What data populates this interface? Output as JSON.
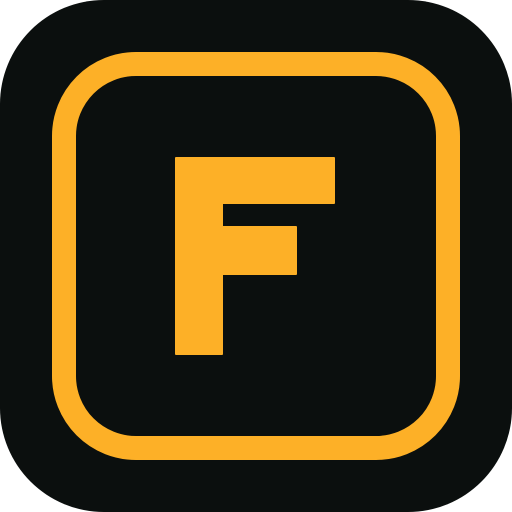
{
  "icon": {
    "name": "app-icon",
    "letter": "F",
    "colors": {
      "background": "#0b0f0e",
      "accent": "#fdb027"
    }
  }
}
